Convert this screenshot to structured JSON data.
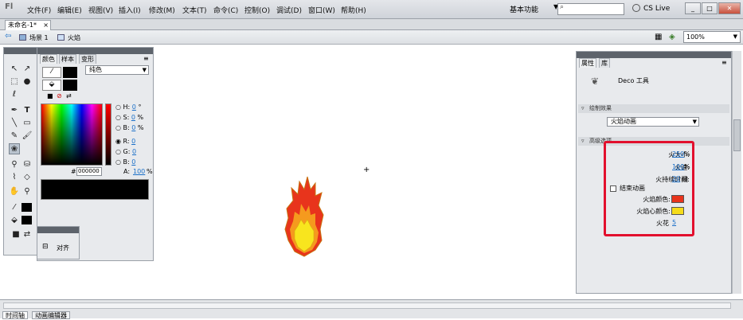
{
  "app": {
    "logo": "Fl",
    "menu": [
      "文件(F)",
      "编辑(E)",
      "视图(V)",
      "插入(I)",
      "修改(M)",
      "文本(T)",
      "命令(C)",
      "控制(O)",
      "调试(D)",
      "窗口(W)",
      "帮助(H)"
    ],
    "workspace": "基本功能",
    "search_placeholder": "",
    "cs_live": "CS Live",
    "window_buttons": [
      "_",
      "□",
      "✕"
    ]
  },
  "document": {
    "tab": "未命名-1*",
    "tab_close": "×",
    "breadcrumb": [
      "场景 1",
      "火焰"
    ],
    "zoom": "100%"
  },
  "color_panel": {
    "tabs": [
      "颜色",
      "样本",
      "变形"
    ],
    "fill_type": "纯色",
    "hsb": [
      {
        "label": "H:",
        "value": "0",
        "unit": "°"
      },
      {
        "label": "S:",
        "value": "0",
        "unit": "%"
      },
      {
        "label": "B:",
        "value": "0",
        "unit": "%"
      }
    ],
    "rgb": [
      {
        "label": "R:",
        "value": "0"
      },
      {
        "label": "G:",
        "value": "0"
      },
      {
        "label": "B:",
        "value": "0"
      }
    ],
    "alpha": {
      "label": "A:",
      "value": "100",
      "unit": "%"
    },
    "hex_label": "#",
    "hex": "000000"
  },
  "align_panel": {
    "label": "对齐"
  },
  "properties": {
    "tabs": [
      "属性",
      "库"
    ],
    "tool_name": "Deco 工具",
    "section_draw": "绘制效果",
    "effect": "火焰动画",
    "section_advanced": "高级选项",
    "rows": [
      {
        "label": "火大小:",
        "value": "250",
        "unit": "%"
      },
      {
        "label": "火速:",
        "value": "100",
        "unit": "%"
      },
      {
        "label": "火持续时间:",
        "value": "20",
        "unit": "帧"
      }
    ],
    "end_anim": "结束动画",
    "flame_color_label": "火焰颜色:",
    "flame_color": "#e8341c",
    "core_color_label": "火焰心颜色:",
    "core_color": "#f5dc1a",
    "sparks_label": "火花",
    "sparks_value": "5"
  },
  "timeline": {
    "tabs": [
      "时间轴",
      "动画编辑器"
    ]
  }
}
